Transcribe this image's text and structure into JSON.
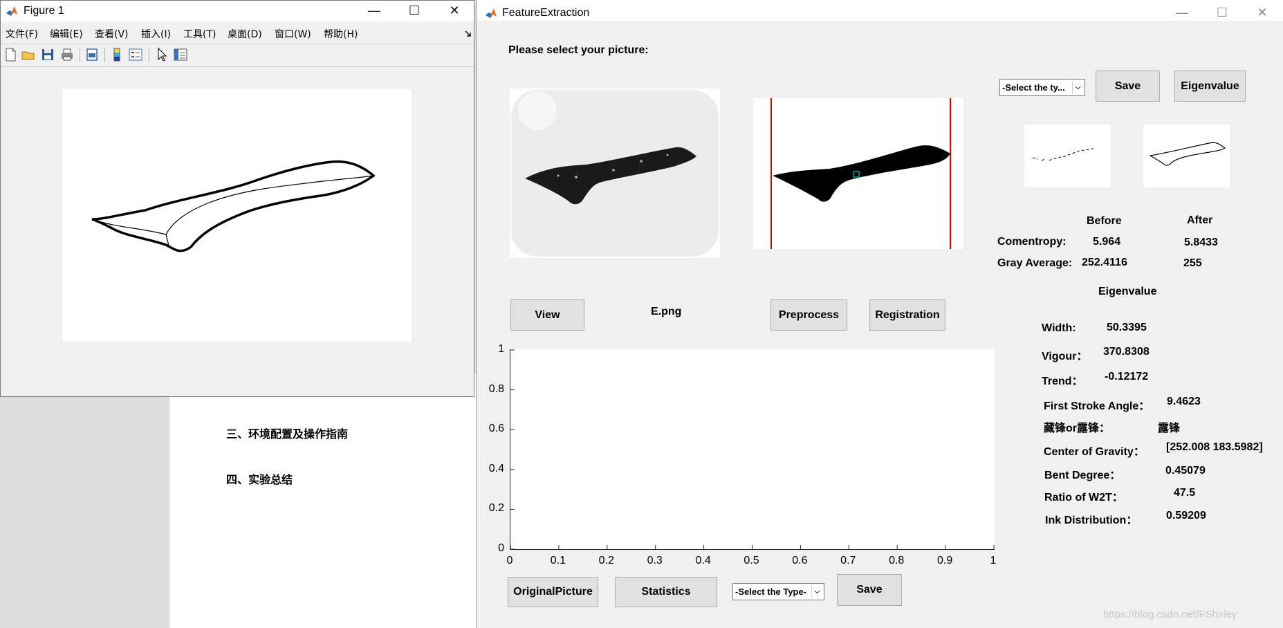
{
  "document": {
    "heading_3": "三、环境配置及操作指南",
    "heading_4": "四、实验总结"
  },
  "figure_window": {
    "title": "Figure 1",
    "controls": {
      "minimize": "—",
      "maximize": "☐",
      "close": "✕"
    },
    "menu": [
      "文件(F)",
      "编辑(E)",
      "查看(V)",
      "插入(I)",
      "工具(T)",
      "桌面(D)",
      "窗口(W)",
      "帮助(H)"
    ],
    "toolbar_icons": [
      "new-figure-icon",
      "open-file-icon",
      "save-icon",
      "print-icon",
      "print-preview-icon",
      "colorbar-icon",
      "legend-icon",
      "pointer-icon",
      "property-editor-icon"
    ]
  },
  "app": {
    "title": "FeatureExtraction",
    "controls": {
      "minimize": "—",
      "maximize": "☐",
      "close": "✕"
    },
    "prompt": "Please select your picture:",
    "filename": "E.png",
    "buttons": {
      "view": "View",
      "preprocess": "Preprocess",
      "registration": "Registration",
      "save_top": "Save",
      "eigenvalue": "Eigenvalue",
      "original_picture": "OriginalPicture",
      "statistics": "Statistics",
      "save_bottom": "Save"
    },
    "select_top": "-Select the ty...",
    "select_bottom": "-Select the Type-",
    "stats": {
      "before_header": "Before",
      "after_header": "After",
      "comentropy_label": "Comentropy:",
      "comentropy_before": "5.964",
      "comentropy_after": "5.8433",
      "gray_label": "Gray Average:",
      "gray_before": "252.4116",
      "gray_after": "255"
    },
    "eigen": {
      "header": "Eigenvalue",
      "width_label": "Width:",
      "width_value": "50.3395",
      "vigour_label": "Vigour：",
      "vigour_value": "370.8308",
      "trend_label": "Trend：",
      "trend_value": "-0.12172",
      "first_stroke_label": "First Stroke Angle：",
      "first_stroke_value": "9.4623",
      "feng_label": "藏锋or露锋：",
      "feng_value": "露锋",
      "gravity_label": "Center of Gravity：",
      "gravity_value": "[252.008 183.5982]",
      "bent_label": "Bent Degree：",
      "bent_value": "0.45079",
      "ratio_label": "Ratio of W2T：",
      "ratio_value": "47.5",
      "ink_label": "Ink Distribution：",
      "ink_value": "0.59209"
    },
    "axes": {
      "x_ticks": [
        "0",
        "0.1",
        "0.2",
        "0.3",
        "0.4",
        "0.5",
        "0.6",
        "0.7",
        "0.8",
        "0.9",
        "1"
      ],
      "y_ticks": [
        "0",
        "0.2",
        "0.4",
        "0.6",
        "0.8",
        "1"
      ]
    },
    "watermark": "https://blog.csdn.net/FShirley"
  },
  "colors": {
    "window_bg": "#f0f0f0",
    "button_bg": "#e1e1e1",
    "registration_line": "#e00000",
    "marker": "#00a0a0"
  }
}
